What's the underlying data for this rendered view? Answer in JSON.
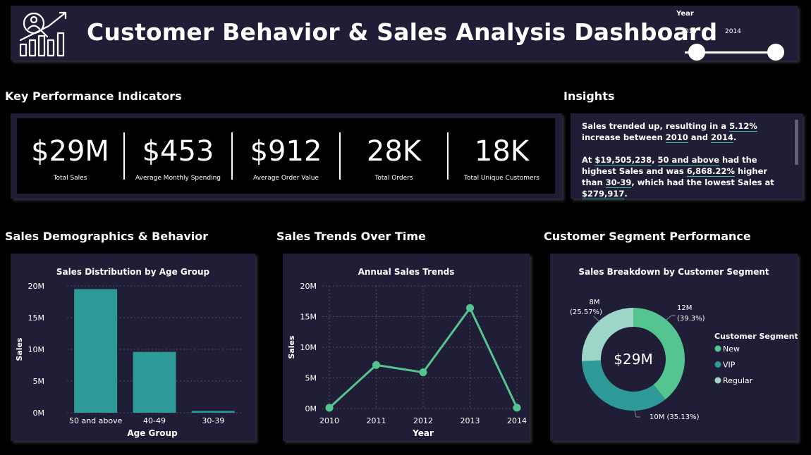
{
  "header": {
    "title": "Customer Behavior & Sales Analysis Dashboard",
    "logo_icon": "analytics-growth-icon",
    "year_slicer": {
      "label": "Year",
      "start": "2010",
      "end": "2014"
    }
  },
  "sections": {
    "kpi": "Key Performance Indicators",
    "insights": "Insights",
    "demographics": "Sales Demographics & Behavior",
    "trends": "Sales Trends Over Time",
    "segments": "Customer Segment Performance"
  },
  "kpis": [
    {
      "value": "$29M",
      "label": "Total Sales"
    },
    {
      "value": "$453",
      "label": "Average Monthly Spending"
    },
    {
      "value": "$912",
      "label": "Average Order Value"
    },
    {
      "value": "28K",
      "label": "Total Orders"
    },
    {
      "value": "18K",
      "label": "Total Unique Customers"
    }
  ],
  "insights": {
    "p1": [
      "Sales trended up, resulting in a ",
      "5.12%",
      " increase between ",
      "2010",
      " and ",
      "2014",
      "."
    ],
    "p2": [
      "At ",
      "$19,505,238",
      ", ",
      "50 and above",
      " had the highest Sales and was ",
      "6,868.22%",
      " higher than ",
      "30-39",
      ", which had the lowest Sales at ",
      "$279,917",
      "."
    ]
  },
  "colors": {
    "panel": "#1f1e36",
    "teal": "#2e9a98",
    "green": "#55c48f",
    "new": "#54c490",
    "vip": "#2e9a98",
    "regular": "#9dd5c8"
  },
  "chart_data": [
    {
      "type": "bar",
      "title": "Sales Distribution by Age Group",
      "xlabel": "Age Group",
      "ylabel": "Sales",
      "categories": [
        "50 and above",
        "40-49",
        "30-39"
      ],
      "values": [
        19505238,
        9600000,
        279917
      ],
      "ylim": [
        0,
        20000000
      ],
      "yticks": [
        "0M",
        "5M",
        "10M",
        "15M",
        "20M"
      ]
    },
    {
      "type": "line",
      "title": "Annual Sales Trends",
      "xlabel": "Year",
      "ylabel": "Sales",
      "x": [
        "2010",
        "2011",
        "2012",
        "2013",
        "2014"
      ],
      "values": [
        120000,
        7100000,
        5900000,
        16400000,
        126000
      ],
      "ylim": [
        0,
        20000000
      ],
      "yticks": [
        "0M",
        "5M",
        "10M",
        "15M",
        "20M"
      ],
      "grid": true
    },
    {
      "type": "pie",
      "title": "Sales Breakdown by Customer Segment",
      "center_label": "$29M",
      "legend_title": "Customer Segment",
      "legend_position": "right",
      "slices": [
        {
          "name": "New",
          "value": 39.3,
          "label": "12M",
          "pct": "(39.3%)"
        },
        {
          "name": "VIP",
          "value": 35.13,
          "label": "10M (35.13%)",
          "pct": ""
        },
        {
          "name": "Regular",
          "value": 25.57,
          "label": "8M",
          "pct": "(25.57%)"
        }
      ]
    }
  ]
}
